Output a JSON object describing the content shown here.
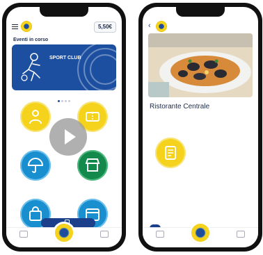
{
  "left_phone": {
    "app_name": "",
    "coins": "5,50€",
    "section_title": "Eventi in corso",
    "banner": {
      "title": "SPORT CLUB",
      "subtitle": ""
    },
    "tiles": [
      {
        "label": "",
        "color": "#f5d21b",
        "icon": "person-icon"
      },
      {
        "label": "",
        "color": "#f5d21b",
        "icon": "ticket-icon"
      },
      {
        "label": "",
        "color": "#1a8fd0",
        "icon": "umbrella-icon"
      },
      {
        "label": "",
        "color": "#138a4b",
        "icon": "shop-icon"
      },
      {
        "label": "",
        "color": "#1a8fd0",
        "icon": "bag-icon"
      },
      {
        "label": "",
        "color": "#1a8fd0",
        "icon": "calendar-icon"
      }
    ],
    "pill_button_label": "",
    "tabbar": {
      "left": "",
      "right": ""
    }
  },
  "right_phone": {
    "app_name": "",
    "restaurant_title": "Ristorante Centrale",
    "restaurant_subtitle": "",
    "hours": "",
    "icon_label": "",
    "description": "",
    "action_button": "",
    "action_text": "",
    "tabbar": {
      "left": "",
      "right": ""
    }
  },
  "colors": {
    "brand_blue": "#1d4fa0",
    "brand_yellow": "#f5d21b",
    "accent_blue": "#1a8fd0",
    "accent_green": "#138a4b"
  }
}
